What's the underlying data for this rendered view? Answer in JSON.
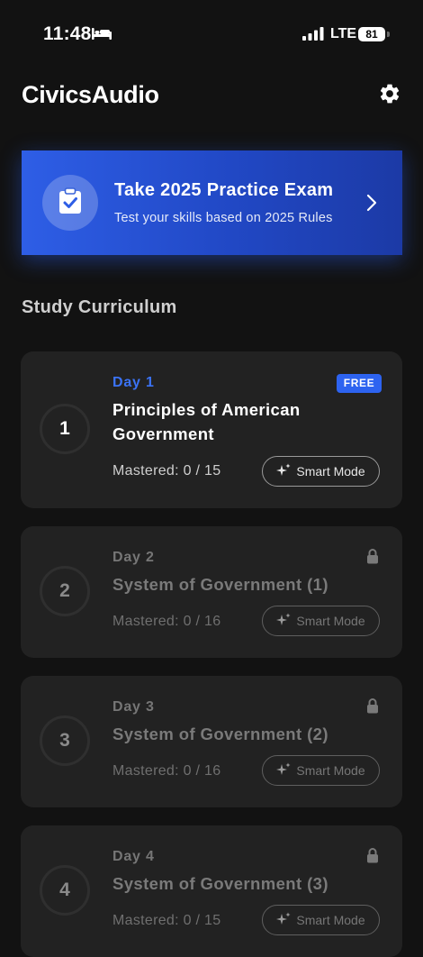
{
  "status_bar": {
    "time": "11:48",
    "network": "LTE",
    "battery": "81"
  },
  "header": {
    "title": "CivicsAudio"
  },
  "exam_banner": {
    "title": "Take 2025 Practice Exam",
    "subtitle": "Test your skills based on 2025 Rules"
  },
  "curriculum": {
    "section_title": "Study Curriculum",
    "days": [
      {
        "number": "1",
        "label": "Day 1",
        "title": "Principles of American Government",
        "mastered": "Mastered: 0 / 15",
        "smart_mode": "Smart Mode",
        "badge": "FREE",
        "locked": false
      },
      {
        "number": "2",
        "label": "Day 2",
        "title": "System of Government (1)",
        "mastered": "Mastered: 0 / 16",
        "smart_mode": "Smart Mode",
        "locked": true
      },
      {
        "number": "3",
        "label": "Day 3",
        "title": "System of Government (2)",
        "mastered": "Mastered: 0 / 16",
        "smart_mode": "Smart Mode",
        "locked": true
      },
      {
        "number": "4",
        "label": "Day 4",
        "title": "System of Government (3)",
        "mastered": "Mastered: 0 / 15",
        "smart_mode": "Smart Mode",
        "locked": true
      }
    ]
  },
  "colors": {
    "background": "#121212",
    "card": "#222222",
    "accent": "#2d63f0",
    "banner_start": "#2e5ee6",
    "banner_end": "#1c3aa6"
  }
}
